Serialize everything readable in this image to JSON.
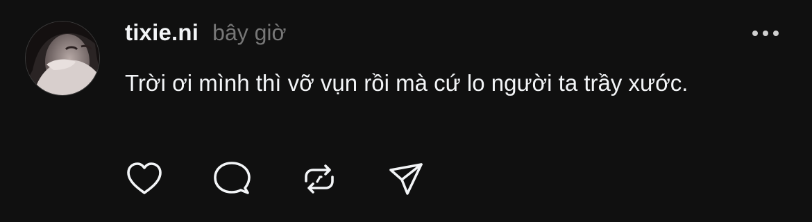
{
  "post": {
    "author": {
      "username": "tixie.ni",
      "avatar_icon": "profile-photo"
    },
    "timestamp": "bây giờ",
    "text": "Trời ơi mình thì vỡ vụn rồi mà cứ lo người ta trầy xước.",
    "more_icon": "ellipsis-horizontal-icon",
    "actions": [
      {
        "icon": "heart-icon"
      },
      {
        "icon": "comment-bubble-icon"
      },
      {
        "icon": "repost-icon"
      },
      {
        "icon": "send-icon"
      }
    ]
  },
  "colors": {
    "background": "#101010",
    "text_primary": "#f3f5f7",
    "text_secondary": "#777777",
    "icon": "#f3f5f7"
  }
}
